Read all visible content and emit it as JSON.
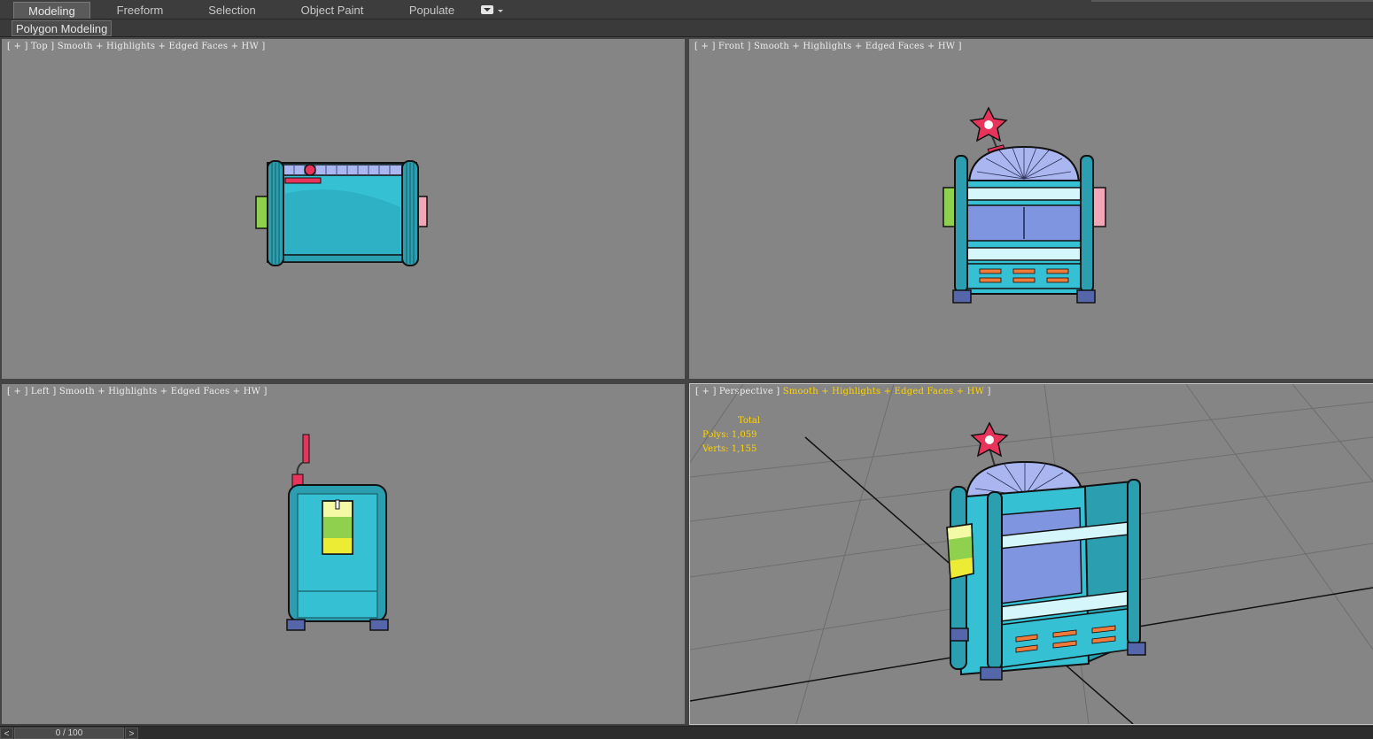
{
  "ribbon": {
    "tabs": [
      {
        "label": "Modeling",
        "active": true
      },
      {
        "label": "Freeform",
        "active": false
      },
      {
        "label": "Selection",
        "active": false
      },
      {
        "label": "Object Paint",
        "active": false
      },
      {
        "label": "Populate",
        "active": false
      }
    ],
    "options_icon": "ribbon-options-icon",
    "subtab": "Polygon Modeling"
  },
  "viewports": [
    {
      "id": "top",
      "label": "[ + ] Top ] Smooth + Highlights + Edged Faces + HW ]"
    },
    {
      "id": "front",
      "label": "[ + ] Front ] Smooth + Highlights + Edged Faces + HW ]"
    },
    {
      "id": "left",
      "label": "[ + ] Left ] Smooth + Highlights + Edged Faces + HW ]"
    },
    {
      "id": "perspective",
      "label_prefix": "[ + ] Perspective ] ",
      "label_highlight": "Smooth + Highlights + Edged Faces + HW",
      "label_suffix": " ]",
      "active": true
    }
  ],
  "stats": {
    "total_label": "Total",
    "polys": "Polys: 1,059",
    "verts": "Verts: 1,155"
  },
  "timeline": {
    "prev_label": "<",
    "next_label": ">",
    "frame": "0 / 100"
  },
  "colors": {
    "viewport_bg": "#858585",
    "ui_bg": "#444444",
    "teal": "#36c0d3",
    "teal_dark": "#1f8a9a",
    "lavender": "#a9b6f0",
    "star_pink": "#e8345a",
    "stats_yellow": "#ffd400",
    "green_tag": "#8fd14f",
    "pink_tag": "#f3a7b6"
  }
}
